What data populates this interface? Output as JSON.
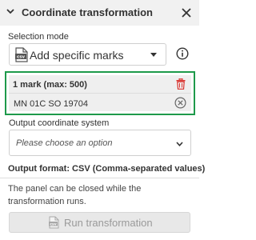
{
  "header": {
    "title": "Coordinate transformation"
  },
  "selection": {
    "label": "Selection mode",
    "value": "Add specific marks"
  },
  "marks": {
    "count_label": "1 mark (max: 500)",
    "items": [
      "MN 01C SO 19704"
    ]
  },
  "output": {
    "label": "Output coordinate system",
    "placeholder": "Please choose an option"
  },
  "format": {
    "text": "Output format: CSV (Comma-separated values)"
  },
  "note": {
    "text": "The panel can be closed while the transformation runs."
  },
  "run": {
    "label": "Run transformation"
  },
  "colors": {
    "highlight": "#1e9a4b",
    "delete": "#d9302c",
    "header_bg": "#f1f1f1"
  }
}
